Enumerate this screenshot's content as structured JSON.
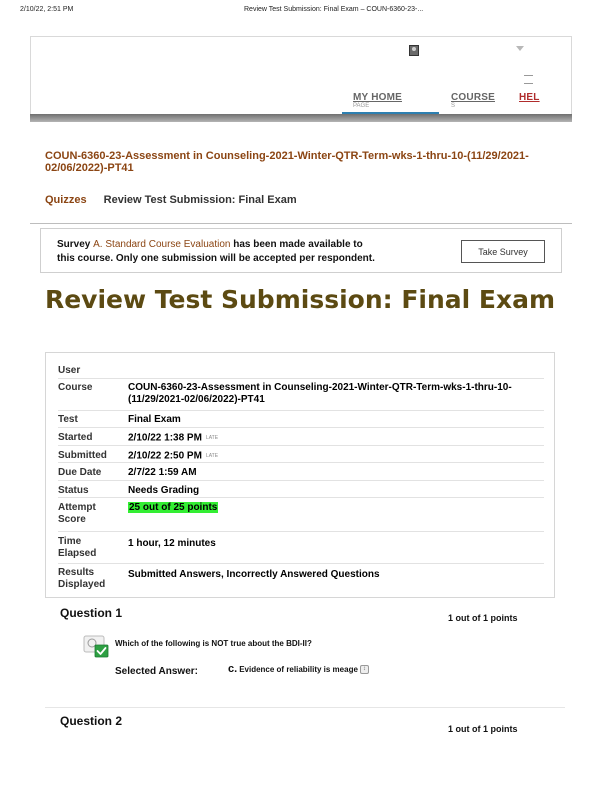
{
  "print_header": {
    "timestamp": "2/10/22, 2:51 PM",
    "page_title": "Review Test Submission: Final Exam – COUN-6360-23-..."
  },
  "nav": {
    "tabs": [
      {
        "label": "MY HOME",
        "clipped": "PAGE"
      },
      {
        "label": "COURSE",
        "clipped": "S"
      },
      {
        "label": "HEL"
      }
    ],
    "icons": [
      "avatar-icon",
      "chevron-down-icon",
      "menu-icon"
    ]
  },
  "course_title": "COUN-6360-23-Assessment in Counseling-2021-Winter-QTR-Term-wks-1-thru-10-(11/29/2021-02/06/2022)-PT41",
  "breadcrumb": {
    "crumb1": "Quizzes",
    "crumb2": "Review Test Submission: Final Exam"
  },
  "survey": {
    "prefix": "Survey",
    "link_text": "A. Standard Course Evaluation",
    "text1": " has been made available to",
    "text2": "this course. Only one submission will be accepted per respondent.",
    "button_label": "Take Survey"
  },
  "page_heading": "Review Test Submission: Final Exam",
  "details": {
    "user_label": "User",
    "user_value": "",
    "course_label": "Course",
    "course_value": "COUN-6360-23-Assessment in Counseling-2021-Winter-QTR-Term-wks-1-thru-10-(11/29/2021-02/06/2022)-PT41",
    "test_label": "Test",
    "test_value": "Final Exam",
    "started_label": "Started",
    "started_value": "2/10/22 1:38 PM",
    "started_badge": "LATE",
    "submitted_label": "Submitted",
    "submitted_value": "2/10/22 2:50 PM",
    "submitted_badge": "LATE",
    "due_label": "Due Date",
    "due_value": "2/7/22 1:59 AM",
    "status_label": "Status",
    "status_value": "Needs Grading",
    "score_label": "Attempt Score",
    "score_value": "25 out of 25 points",
    "time_label": "Time Elapsed",
    "time_value": "1 hour, 12 minutes",
    "results_label": "Results Displayed",
    "results_value": "Submitted Answers, Incorrectly Answered Questions"
  },
  "questions": [
    {
      "title": "Question 1",
      "points": "1 out of 1 points",
      "text": "Which of the following is NOT true about the BDI-II?",
      "selected_label": "Selected Answer:",
      "selected_letter": "c.",
      "selected_text": "Evidence of reliability is meage"
    },
    {
      "title": "Question 2",
      "points": "1 out of 1 points"
    }
  ],
  "colors": {
    "course_link": "#8b4513",
    "heading": "#5c4a12",
    "score_highlight": "#33ee33",
    "nav_underline": "#2d7fb0"
  }
}
